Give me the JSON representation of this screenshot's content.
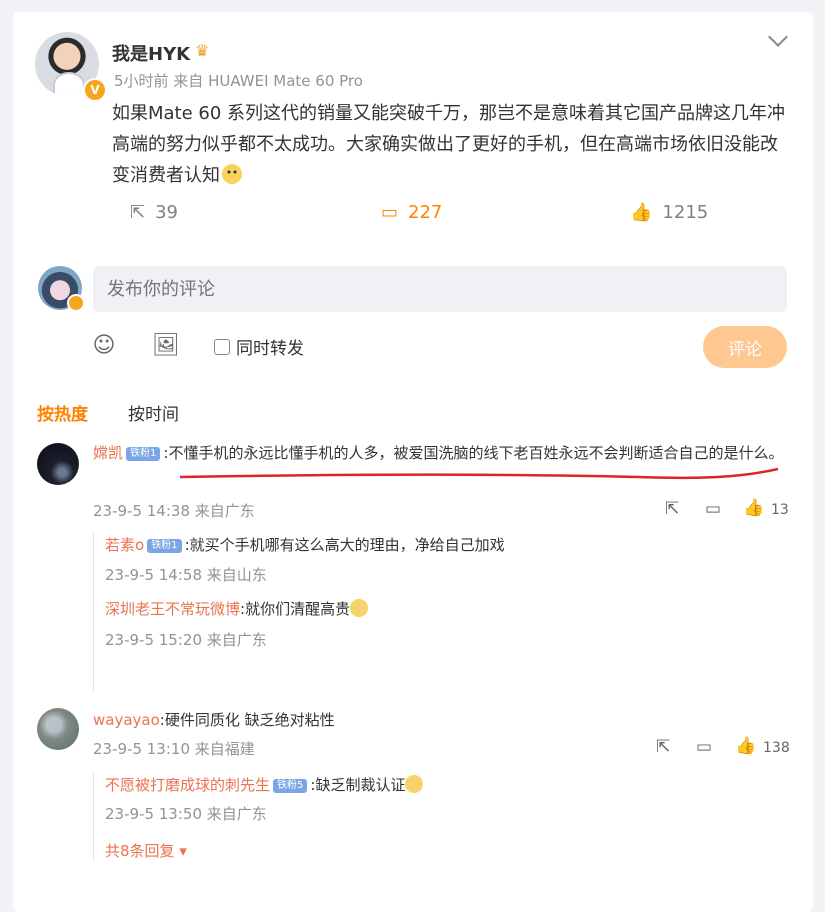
{
  "post": {
    "author": "我是HYK",
    "meta": "5小时前 来自 HUAWEI Mate 60 Pro",
    "text": "如果Mate 60 系列这代的销量又能突破千万，那岂不是意味着其它国产品牌这几年冲高端的努力似乎都不太成功。大家确实做出了更好的手机，但在高端市场依旧没能改变消费者认知",
    "reposts": "39",
    "comments": "227",
    "likes": "1215"
  },
  "composer": {
    "placeholder": "发布你的评论",
    "repost_label": "同时转发",
    "submit_label": "评论"
  },
  "sort": {
    "hot": "按热度",
    "time": "按时间"
  },
  "comments": [
    {
      "name": "嫦凯",
      "badge": "铁粉1",
      "text": ":不懂手机的永远比懂手机的人多，被爱国洗脑的线下老百姓永远不会判断适合自己的是什么。",
      "time": "23-9-5 14:38 来自广东",
      "likes": "13",
      "replies": [
        {
          "name": "若素o",
          "badge": "铁粉1",
          "text": ":就买个手机哪有这么高大的理由，净给自己加戏",
          "time": "23-9-5 14:58 来自山东"
        },
        {
          "name": "深圳老王不常玩微博",
          "text": ":就你们清醒高贵",
          "time": "23-9-5 15:20 来自广东"
        }
      ]
    },
    {
      "name": "wayayao",
      "text": ":硬件同质化 缺乏绝对粘性",
      "time": "23-9-5 13:10 来自福建",
      "likes": "138",
      "replies": [
        {
          "name": "不愿被打磨成球的刺先生",
          "badge": "铁粉5",
          "text": ":缺乏制裁认证",
          "time": "23-9-5 13:50 来自广东"
        }
      ],
      "more": "共8条回复"
    }
  ],
  "colors": {
    "accent": "#ff8200",
    "name": "#eb7350",
    "submit": "#ffc891",
    "annotation": "#d8262b"
  }
}
